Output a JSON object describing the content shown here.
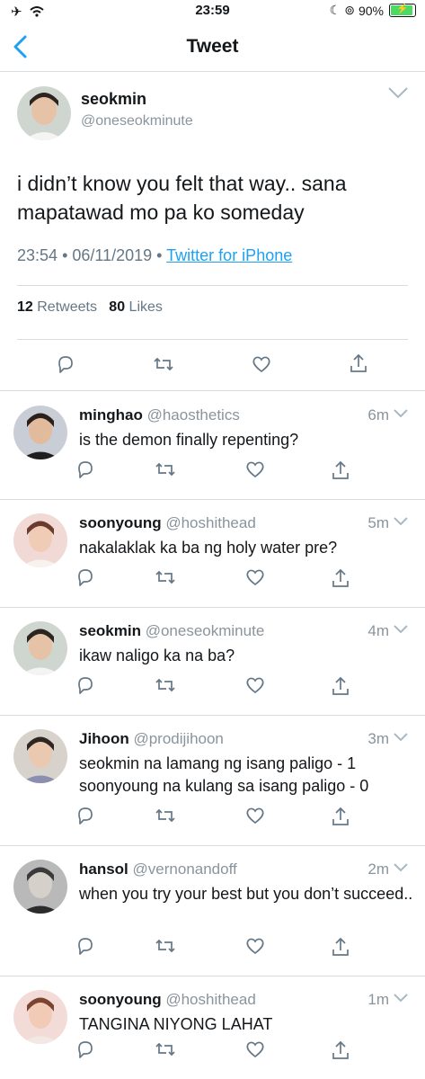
{
  "status_bar": {
    "time": "23:59",
    "battery_percent": "90%",
    "left_icons": [
      "airplane-icon",
      "wifi-icon"
    ],
    "right_icons": [
      "moon-icon",
      "orientation-lock-icon"
    ]
  },
  "nav": {
    "title": "Tweet"
  },
  "main_tweet": {
    "name": "seokmin",
    "handle": "@oneseokminute",
    "text": "i didn’t know you felt that way.. sana mapatawad mo pa ko someday",
    "time": "23:54",
    "date": "06/11/2019",
    "separator": "•",
    "source": "Twitter for iPhone",
    "retweets_count": "12",
    "retweets_label": "Retweets",
    "likes_count": "80",
    "likes_label": "Likes"
  },
  "replies": [
    {
      "name": "minghao",
      "handle": "@haosthetics",
      "time": "6m",
      "text": "is the demon finally repenting?"
    },
    {
      "name": "soonyoung",
      "handle": "@hoshithead",
      "time": "5m",
      "text": "nakalaklak ka ba ng holy water pre?"
    },
    {
      "name": "seokmin",
      "handle": "@oneseokminute",
      "time": "4m",
      "text": "ikaw naligo ka na ba?"
    },
    {
      "name": "Jihoon",
      "handle": "@prodijihoon",
      "time": "3m",
      "text": "seokmin na lamang ng isang paligo - 1\nsoonyoung na kulang sa isang paligo - 0"
    },
    {
      "name": "hansol",
      "handle": "@vernonandoff",
      "time": "2m",
      "text": "when you try your best but you don’t succeed.."
    },
    {
      "name": "soonyoung",
      "handle": "@hoshithead",
      "time": "1m",
      "text": "TANGINA NIYONG LAHAT"
    }
  ],
  "colors": {
    "accent": "#1da1f2",
    "text": "#14171a",
    "secondary": "#657786",
    "divider": "#d8dde1",
    "battery": "#4cd964"
  }
}
